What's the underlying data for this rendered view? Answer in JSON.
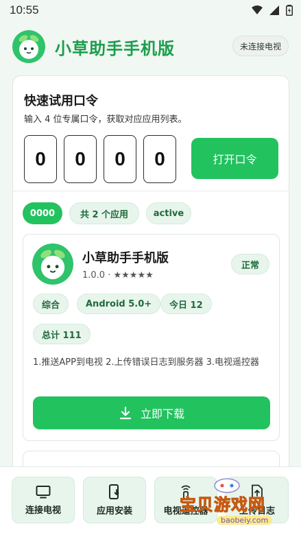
{
  "status_bar": {
    "time": "10:55"
  },
  "header": {
    "title": "小草助手手机版",
    "connection_status": "未连接电视"
  },
  "quick_try": {
    "title": "快速试用口令",
    "subtitle": "输入 4 位专属口令，获取对应应用列表。",
    "digits": [
      "0",
      "0",
      "0",
      "0"
    ],
    "open_button": "打开口令"
  },
  "result_chips": {
    "code": "0000",
    "count": "共 2 个应用",
    "state": "active"
  },
  "app": {
    "name": "小草助手手机版",
    "version": "1.0.0",
    "rating_text": "· ★★★★★",
    "status": "正常",
    "tags": [
      "综合",
      "Android 5.0+",
      "今日 12",
      "总计 111"
    ],
    "description": "1.推送APP到电视   2.上传错误日志到服务器   3.电视遥控器",
    "download_button": "立即下载"
  },
  "bottom_nav": {
    "items": [
      {
        "label": "连接电视",
        "icon": "tv-icon"
      },
      {
        "label": "应用安装",
        "icon": "phone-install-icon"
      },
      {
        "label": "电视遥控器",
        "icon": "remote-icon"
      },
      {
        "label": "上传日志",
        "icon": "upload-log-icon"
      }
    ]
  },
  "watermark": {
    "text": "宝贝游戏网",
    "url": "baobeiy.com"
  },
  "colors": {
    "accent": "#22c25f",
    "title_green": "#1b9e4b",
    "chip_bg": "#e8f5ec"
  }
}
